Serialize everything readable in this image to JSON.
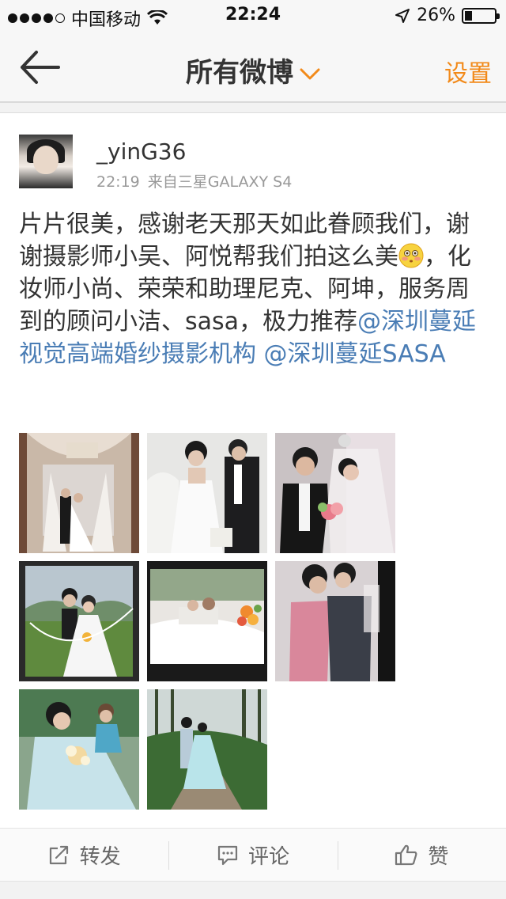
{
  "status_bar": {
    "carrier": "中国移动",
    "time": "22:24",
    "battery_percent": "26%",
    "battery_level": 0.26,
    "signal_dots_filled": 4,
    "signal_dots_total": 5
  },
  "nav": {
    "back_icon": "arrow-left-icon",
    "title": "所有微博",
    "title_dropdown_icon": "chevron-down-icon",
    "settings_label": "设置"
  },
  "post": {
    "username": "_yinG36",
    "time": "22:19",
    "source": "来自三星GALAXY S4",
    "text_part1": "片片很美，感谢老天那天如此眷顾我们，谢谢摄影师小吴、阿悦帮我们拍这么美",
    "emoji_icon": "blushing-face-icon",
    "text_part2": "，化妆师小尚、荣荣和助理尼克、阿坤，服务周到的顾问小洁、sasa，极力推荐",
    "mention1": "@深圳蔓延视觉高端婚纱摄影机构",
    "mention2": "@深圳蔓延SASA",
    "photo_count": 8
  },
  "actions": {
    "repost_label": "转发",
    "repost_icon": "share-icon",
    "comment_label": "评论",
    "comment_icon": "comment-icon",
    "like_label": "赞",
    "like_icon": "thumbs-up-icon"
  },
  "colors": {
    "accent_orange": "#f28a1a",
    "mention_blue": "#4a7db5"
  }
}
